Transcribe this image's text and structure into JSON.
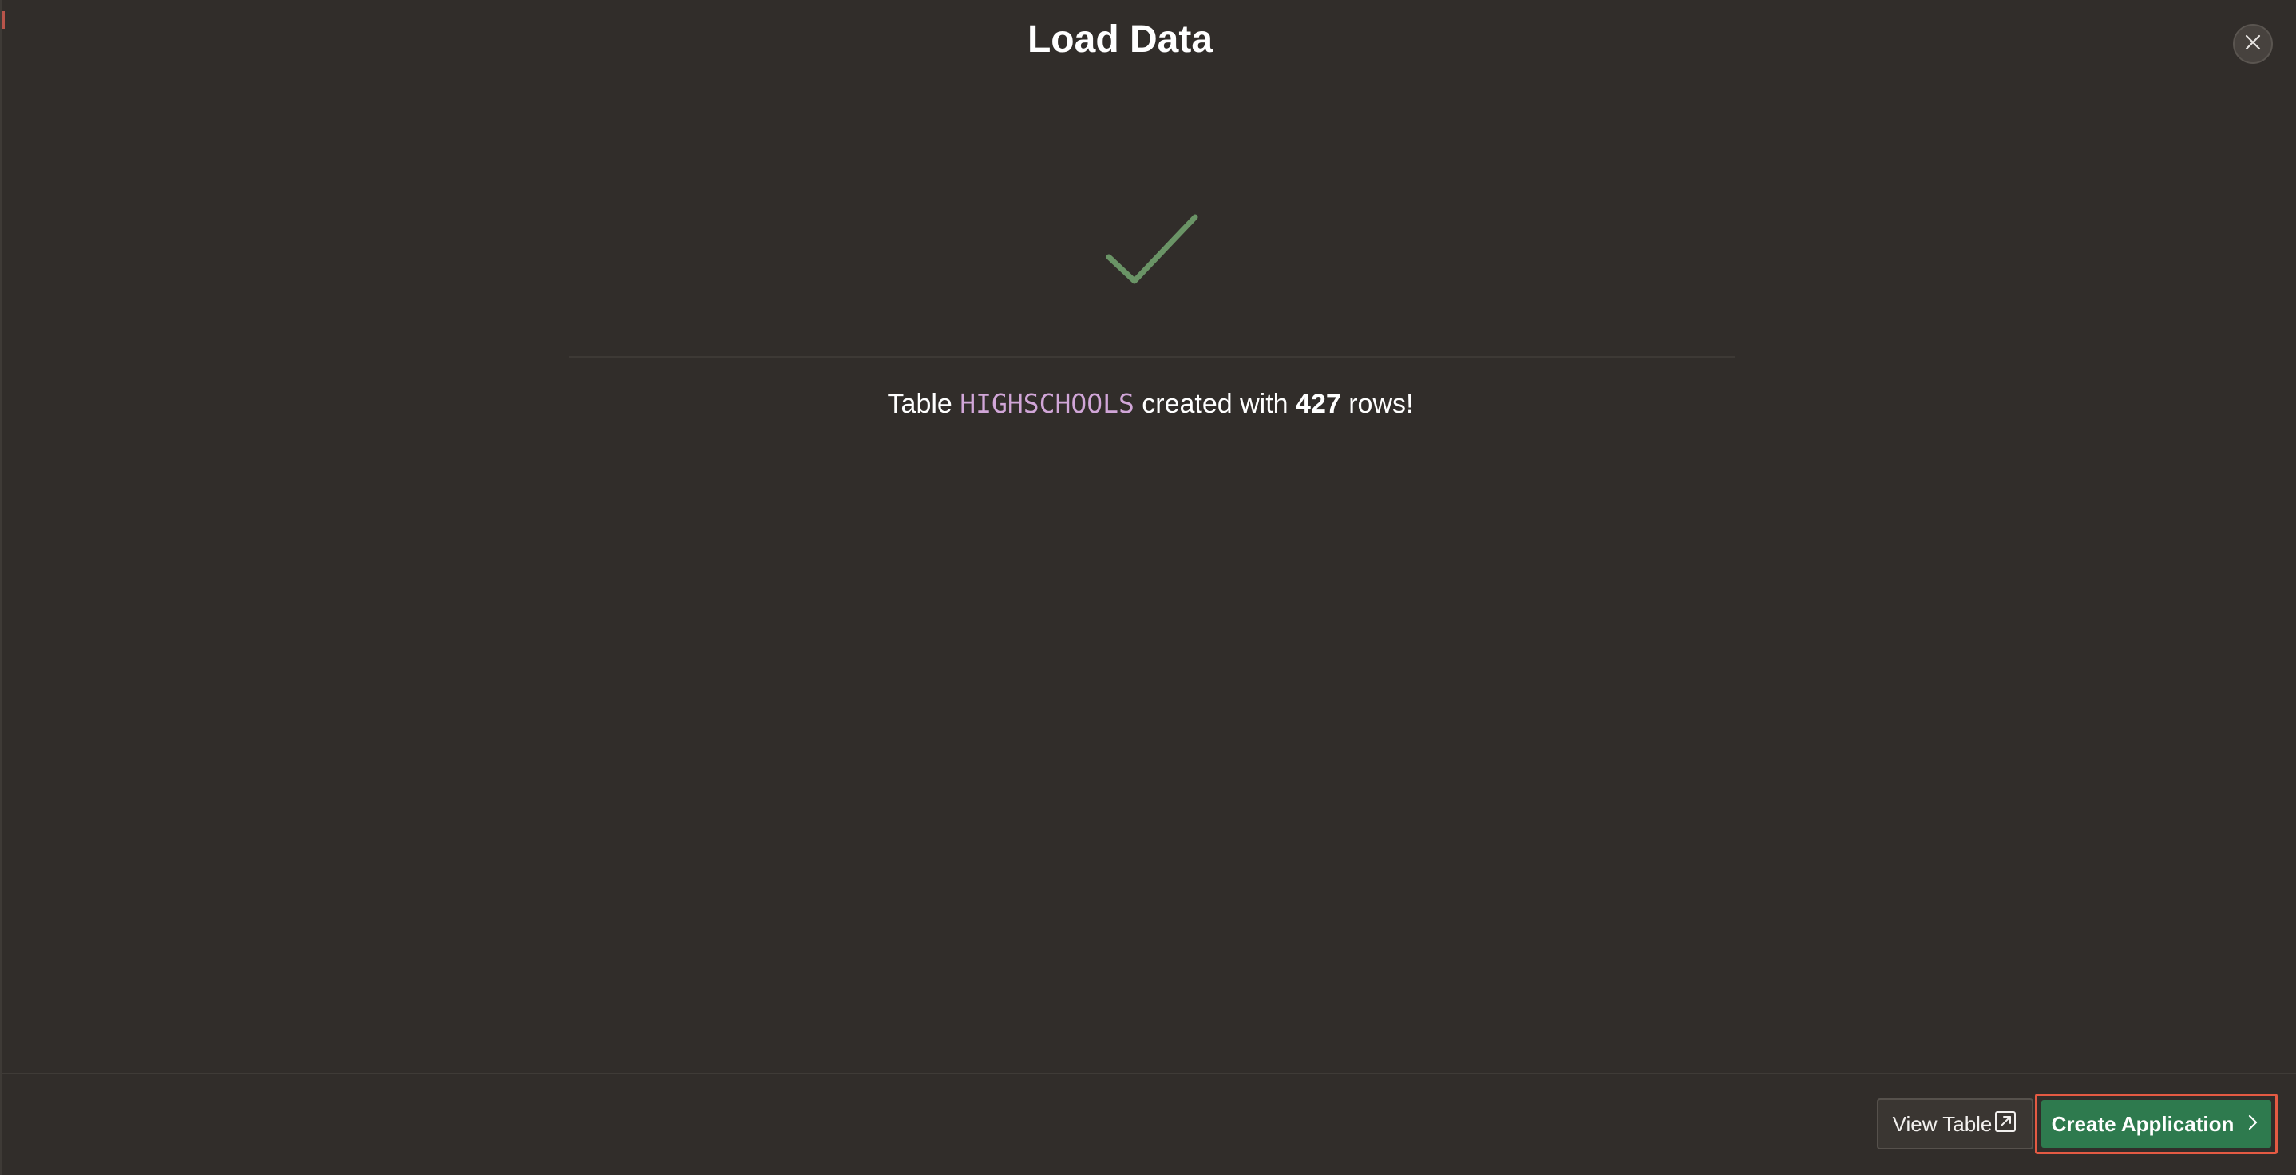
{
  "dialog": {
    "title": "Load Data",
    "close_icon": "close-icon"
  },
  "result": {
    "status_icon": "checkmark-icon",
    "status_color": "#6a9466",
    "prefix": "Table",
    "table_name": "HIGHSCHOOLS",
    "middle": "created with",
    "row_count": "427",
    "suffix": "rows!"
  },
  "footer": {
    "view_table_label": "View Table",
    "view_table_icon": "external-link-icon",
    "create_app_label": "Create Application",
    "create_app_icon": "chevron-right-icon",
    "primary_color": "#2e7a4e",
    "highlight_color": "#e45a43"
  }
}
